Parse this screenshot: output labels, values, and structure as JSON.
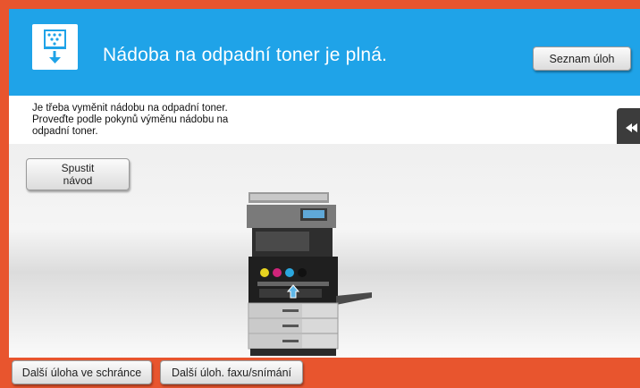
{
  "header": {
    "title": "Nádoba na odpadní toner je plná.",
    "job_list_button": "Seznam úloh",
    "background_color": "#1fa3e8"
  },
  "message": {
    "lines": [
      "Je třeba vyměnit nádobu na odpadní toner.",
      "Proveďte podle pokynů výměnu nádobu na",
      "odpadní toner."
    ]
  },
  "guide_button": {
    "line1": "Spustit",
    "line2": "návod"
  },
  "side_tab": {
    "icon": "double-chevron-left-icon"
  },
  "bottom_bar": {
    "box_job_button": "Další úloha ve schránce",
    "fax_scan_button": "Další úloh. faxu/snímání",
    "background_color": "#e8552e"
  },
  "illustration": {
    "icon": "waste-toner-icon"
  }
}
